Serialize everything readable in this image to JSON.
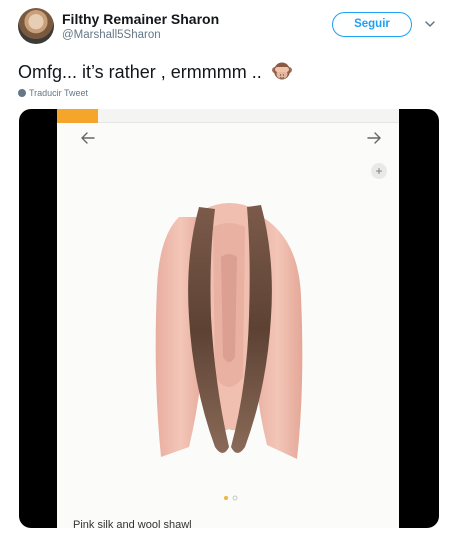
{
  "author": {
    "name": "Filthy Remainer Sharon",
    "handle": "@Marshall5Sharon"
  },
  "follow_button": {
    "label": "Seguir"
  },
  "tweet": {
    "text": "Omfg... it’s rather , ermmmm ..",
    "emoji": "see-no-evil-monkey-icon"
  },
  "translate": {
    "label": "Traducir Tweet"
  },
  "media": {
    "caption": "Pink silk and wool shawl",
    "image_alt": "pink shawl with fur trim"
  },
  "colors": {
    "accent": "#1da1f2",
    "text": "#14171a",
    "muted": "#657786"
  }
}
